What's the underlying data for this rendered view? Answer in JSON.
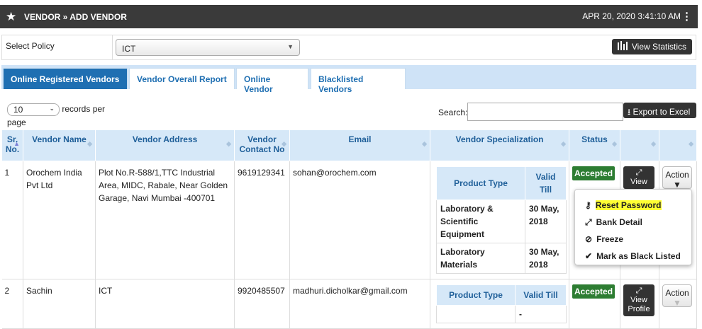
{
  "header": {
    "title": "VENDOR » ADD VENDOR",
    "datetime": "APR 20, 2020   3:41:10 AM"
  },
  "policy": {
    "label": "Select Policy",
    "value": "ICT",
    "stats_button": "View Statistics"
  },
  "tabs": [
    "Online Registered Vendors",
    "Vendor Overall Report",
    "Online Vendor",
    "Blacklisted Vendors"
  ],
  "length": {
    "value": "10",
    "suffix": "records per",
    "suffix2": "page"
  },
  "search": {
    "label": "Search:",
    "value": ""
  },
  "export_button": "Export to Excel",
  "columns": [
    "Sr. No.",
    "Vendor Name",
    "Vendor Address",
    "Vendor Contact No",
    "Email",
    "Vendor Specialization",
    "Status",
    "",
    ""
  ],
  "inner_headers": {
    "type": "Product Type",
    "till": "Valid Till"
  },
  "rows": [
    {
      "sr": "1",
      "name": "Orochem India Pvt Ltd",
      "address": "Plot No.R-588/1,TTC Industrial Area, MIDC, Rabale, Near Golden Garage, Navi Mumbai -400701",
      "contact": "9619129341",
      "email": "sohan@orochem.com",
      "spec": [
        {
          "type": "Laboratory & Scientific Equipment",
          "till": "30 May, 2018"
        },
        {
          "type": "Laboratory Materials",
          "till": "30 May, 2018"
        }
      ],
      "status": "Accepted",
      "view": "View",
      "action": "Action"
    },
    {
      "sr": "2",
      "name": "Sachin",
      "address": "ICT",
      "contact": "9920485507",
      "email": "madhuri.dicholkar@gmail.com",
      "spec": [
        {
          "type": "",
          "till": "-"
        }
      ],
      "status": "Accepted",
      "view": "View Profile",
      "action": "Action"
    }
  ],
  "menu": [
    "Reset Password",
    "Bank Detail",
    "Freeze",
    "Mark as Black Listed"
  ]
}
